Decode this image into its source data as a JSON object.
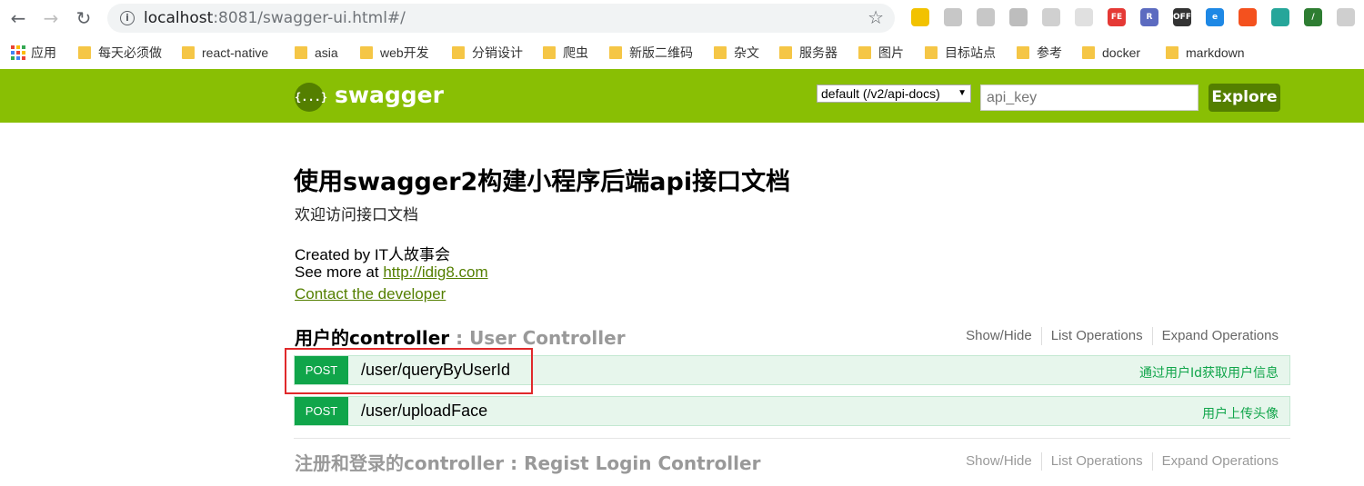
{
  "browser": {
    "url_host": "localhost",
    "url_rest": ":8081/swagger-ui.html#/",
    "bookmarks": [
      {
        "label": "应用"
      },
      {
        "label": "每天必须做"
      },
      {
        "label": "react-native"
      },
      {
        "label": "asia"
      },
      {
        "label": "web开发"
      },
      {
        "label": "分销设计"
      },
      {
        "label": "爬虫"
      },
      {
        "label": "新版二维码"
      },
      {
        "label": "杂文"
      },
      {
        "label": "服务器"
      },
      {
        "label": "图片"
      },
      {
        "label": "目标站点"
      },
      {
        "label": "参考"
      },
      {
        "label": "docker"
      },
      {
        "label": "markdown"
      }
    ],
    "extensions": [
      {
        "name": "yellow-extension-icon",
        "label": "",
        "color": "#f2c200"
      },
      {
        "name": "gray-extension-icon-1",
        "label": "",
        "color": "#c7c7c7"
      },
      {
        "name": "gray-extension-icon-2",
        "label": "",
        "color": "#c7c7c7"
      },
      {
        "name": "rp-extension-icon",
        "label": "",
        "color": "#bdbdbd"
      },
      {
        "name": "gray-extension-icon-3",
        "label": "",
        "color": "#d0d0d0"
      },
      {
        "name": "gray-extension-icon-4",
        "label": "",
        "color": "#e0e0e0"
      },
      {
        "name": "fe-extension-icon",
        "label": "FE",
        "color": "#e53935"
      },
      {
        "name": "r-extension-icon",
        "label": "R",
        "color": "#5c6bc0"
      },
      {
        "name": "off-extension-icon",
        "label": "OFF",
        "color": "#333333"
      },
      {
        "name": "e-extension-icon",
        "label": "e",
        "color": "#1e88e5"
      },
      {
        "name": "orange-extension-icon",
        "label": "",
        "color": "#f4511e"
      },
      {
        "name": "vue-extension-icon",
        "label": "",
        "color": "#26a69a"
      },
      {
        "name": "slash-extension-icon",
        "label": "/",
        "color": "#2e7d32"
      },
      {
        "name": "shield-extension-icon",
        "label": "",
        "color": "#cfcfcf"
      }
    ]
  },
  "swagger": {
    "logo_symbol": "{...}",
    "logo_text": "swagger",
    "api_select": "default (/v2/api-docs)",
    "api_key_placeholder": "api_key",
    "explore_label": "Explore",
    "accent_color": "#89bf04"
  },
  "info": {
    "title": "使用swagger2构建小程序后端api接口文档",
    "description": "欢迎访问接口文档",
    "created_by": "Created by IT人故事会",
    "see_more_prefix": "See more at ",
    "see_more_link": "http://idig8.com",
    "contact": "Contact the developer"
  },
  "resources": [
    {
      "name_cn": "用户的controller",
      "name_en": " : User Controller",
      "ops": [
        "Show/Hide",
        "List Operations",
        "Expand Operations"
      ],
      "operations": [
        {
          "method": "POST",
          "path": "/user/queryByUserId",
          "summary": "通过用户Id获取用户信息"
        },
        {
          "method": "POST",
          "path": "/user/uploadFace",
          "summary": "用户上传头像"
        }
      ]
    },
    {
      "name_cn": "注册和登录的controller",
      "name_en": " : Regist Login Controller",
      "ops": [
        "Show/Hide",
        "List Operations",
        "Expand Operations"
      ]
    }
  ]
}
